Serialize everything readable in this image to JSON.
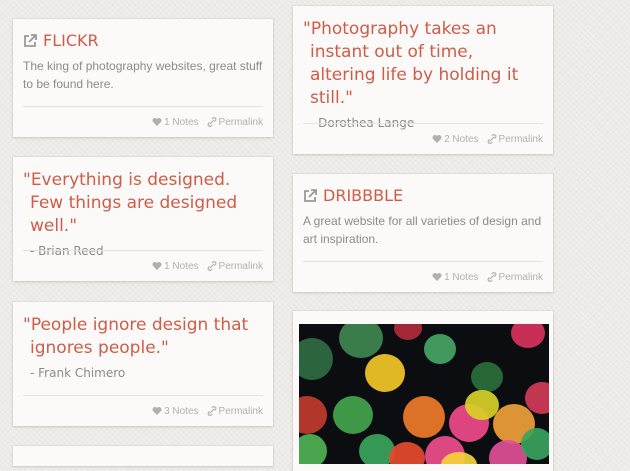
{
  "colors": {
    "accent": "#cf5c48",
    "muted": "#8b8b88",
    "meta": "#b1b0ad"
  },
  "cards": {
    "flickr": {
      "title": "FLICKR",
      "description": "The king of photography websites, great stuff to be found here.",
      "notes": "1 Notes",
      "permalink": "Permalink",
      "icon": "external-link-icon"
    },
    "quote_photography": {
      "quote": "\"Photography takes an instant out of time, altering life by holding it still.\"",
      "author": "- Dorothea Lange",
      "notes": "2 Notes",
      "permalink": "Permalink"
    },
    "quote_designed": {
      "quote": "\"Everything is designed. Few things are designed well.\"",
      "author": "- Brian Reed",
      "notes": "1 Notes",
      "permalink": "Permalink"
    },
    "dribbble": {
      "title": "DRIBBBLE",
      "description": "A great website for all varieties of design and art inspiration.",
      "notes": "1 Notes",
      "permalink": "Permalink",
      "icon": "external-link-icon"
    },
    "quote_people": {
      "quote": "\"People ignore design that ignores people.\"",
      "author": "- Frank Chimero",
      "notes": "3 Notes",
      "permalink": "Permalink"
    },
    "photo": {
      "subject": "colorful bokeh lights"
    }
  }
}
